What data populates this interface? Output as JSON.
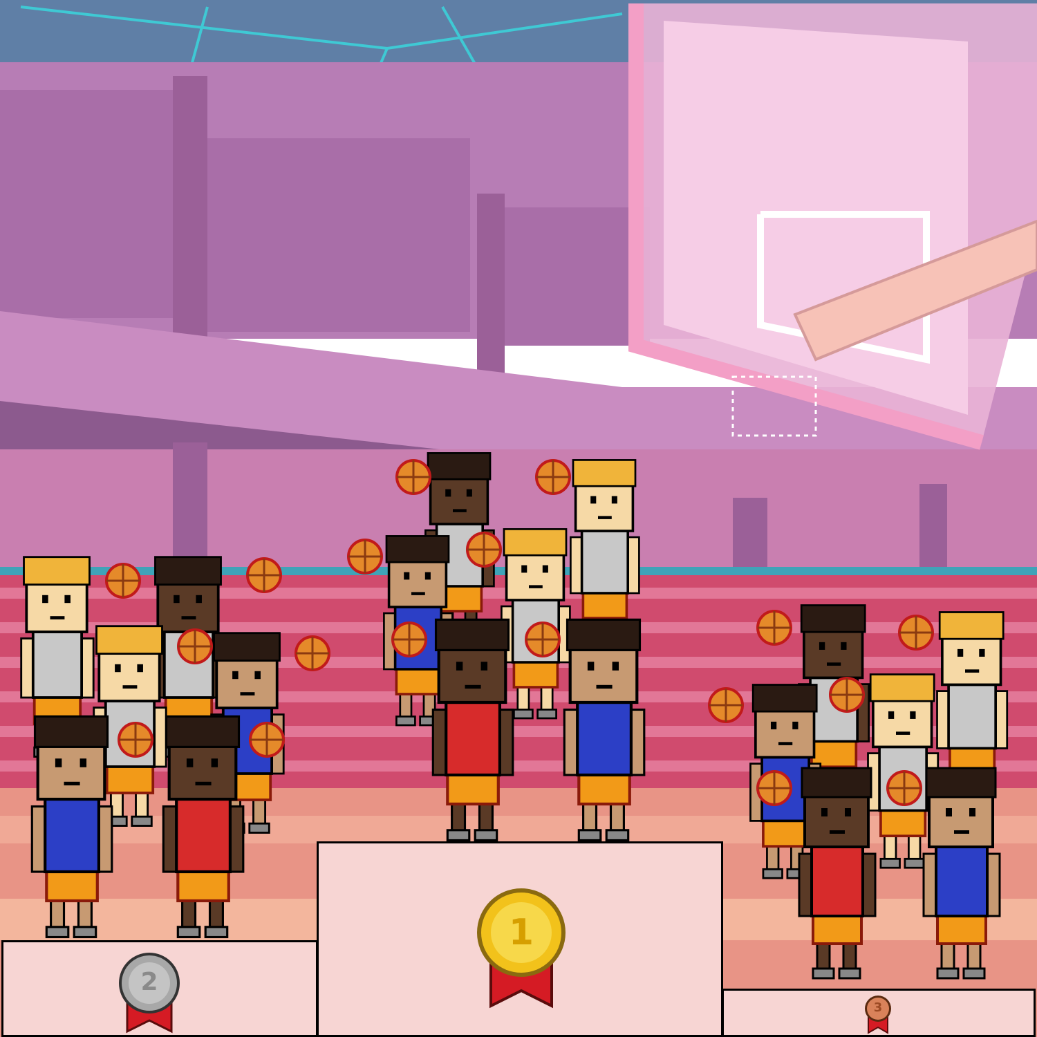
{
  "scene": {
    "name": "basketball-arena-victory-podium",
    "palette": {
      "sky": "#5f7fa6",
      "wall": "#b77db5",
      "wall_dark": "#8c5a8e",
      "court": "#e78a8a",
      "seats": "#c43d63",
      "backboard": "#f3a9c9",
      "podium": "#f7d5d3",
      "gold": "#f2c21b",
      "silver": "#a8a8a8",
      "bronze": "#d9825a",
      "ribbon": "#d51b24",
      "jersey_red": "#d72b2b",
      "jersey_blue": "#2c3fc6",
      "jersey_grey": "#c8c8c8",
      "shorts": "#f29a18"
    }
  },
  "podium": {
    "first": {
      "place": "1",
      "medal": "gold"
    },
    "second": {
      "place": "2",
      "medal": "silver"
    },
    "third": {
      "place": "3",
      "medal": "bronze"
    }
  }
}
